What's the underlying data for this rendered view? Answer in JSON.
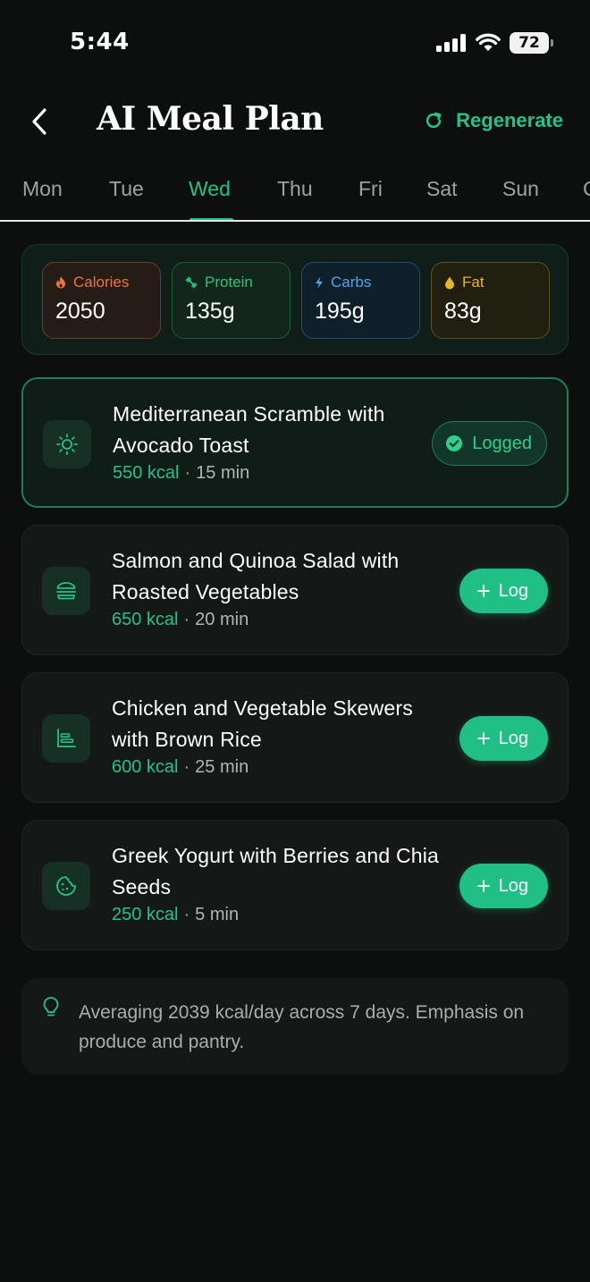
{
  "status_bar": {
    "time": "5:44",
    "battery": "72"
  },
  "header": {
    "title": "AI Meal Plan",
    "regenerate_label": "Regenerate"
  },
  "day_tabs": [
    "Mon",
    "Tue",
    "Wed",
    "Thu",
    "Fri",
    "Sat",
    "Sun",
    "C"
  ],
  "active_day": "Wed",
  "macros": {
    "calories": {
      "label": "Calories",
      "value": "2050"
    },
    "protein": {
      "label": "Protein",
      "value": "135g"
    },
    "carbs": {
      "label": "Carbs",
      "value": "195g"
    },
    "fat": {
      "label": "Fat",
      "value": "83g"
    }
  },
  "meals": [
    {
      "title": "Mediterranean Scramble with Avocado Toast",
      "kcal": "550 kcal",
      "time": "15 min",
      "status": "Logged",
      "icon": "sun-icon"
    },
    {
      "title": "Salmon and Quinoa Salad with Roasted Vegetables",
      "kcal": "650 kcal",
      "time": "20 min",
      "status": "Log",
      "icon": "burger-icon"
    },
    {
      "title": "Chicken and Vegetable Skewers with Brown Rice",
      "kcal": "600 kcal",
      "time": "25 min",
      "status": "Log",
      "icon": "chart-icon"
    },
    {
      "title": "Greek Yogurt with Berries and Chia Seeds",
      "kcal": "250 kcal",
      "time": "5 min",
      "status": "Log",
      "icon": "cookie-icon"
    }
  ],
  "tip": {
    "text": "Averaging 2039 kcal/day across 7 days. Emphasis on produce and pantry."
  },
  "colors": {
    "accent": "#23c28b",
    "background": "#0d0f0f",
    "calories": "#f0733d",
    "protein": "#27c77c",
    "carbs": "#4fa3ec",
    "fat": "#e7b52a"
  }
}
